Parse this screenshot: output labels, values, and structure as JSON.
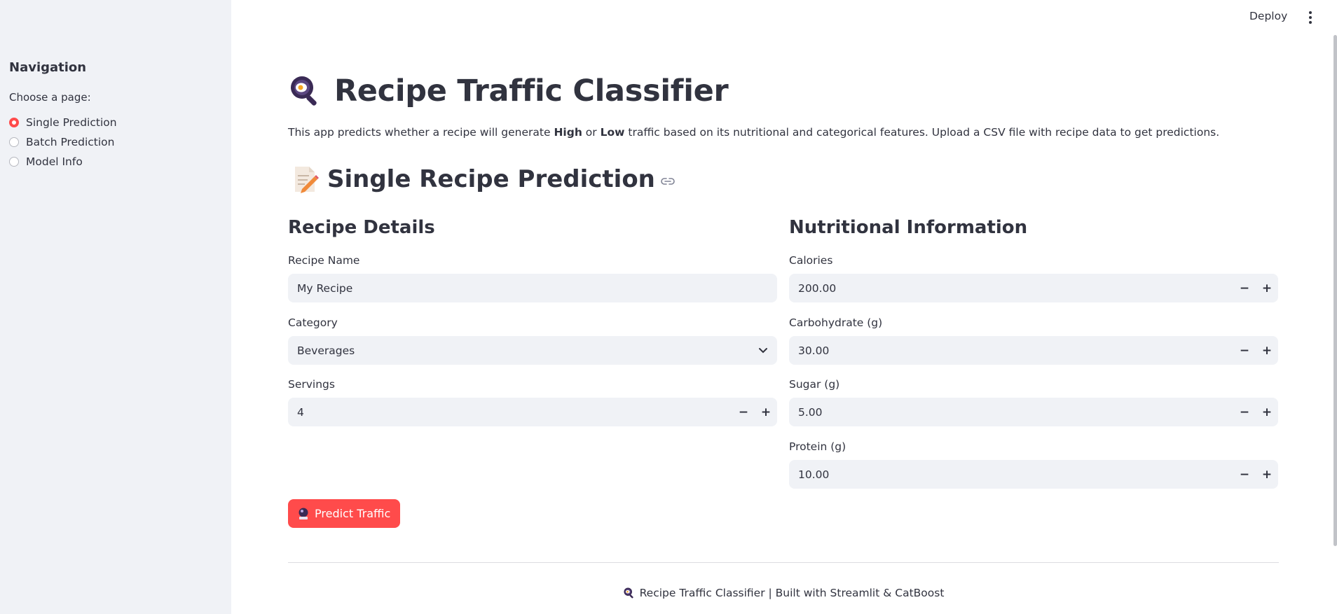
{
  "sidebar": {
    "heading": "Navigation",
    "choose_label": "Choose a page:",
    "options": [
      "Single Prediction",
      "Batch Prediction",
      "Model Info"
    ],
    "selected": "Single Prediction"
  },
  "header": {
    "deploy_label": "Deploy",
    "menu_icon": "kebab-menu-icon"
  },
  "main": {
    "title": "Recipe Traffic Classifier",
    "title_icon": "magnifier-egg-icon",
    "intro": {
      "part1": "This app predicts whether a recipe will generate ",
      "high": "High",
      "part2": " or ",
      "low": "Low",
      "part3": " traffic based on its nutritional and categorical features. Upload a CSV file with recipe data to get predictions."
    },
    "section_title": "Single Recipe Prediction",
    "section_icon": "memo-icon",
    "left_col": {
      "heading": "Recipe Details",
      "recipe_name": {
        "label": "Recipe Name",
        "value": "My Recipe"
      },
      "category": {
        "label": "Category",
        "value": "Beverages"
      },
      "servings": {
        "label": "Servings",
        "value": "4"
      }
    },
    "right_col": {
      "heading": "Nutritional Information",
      "calories": {
        "label": "Calories",
        "value": "200.00"
      },
      "carbohydrate": {
        "label": "Carbohydrate (g)",
        "value": "30.00"
      },
      "sugar": {
        "label": "Sugar (g)",
        "value": "5.00"
      },
      "protein": {
        "label": "Protein (g)",
        "value": "10.00"
      }
    },
    "stepper_minus": "−",
    "stepper_plus": "+",
    "predict_button": "Predict Traffic",
    "predict_icon": "crystal-ball-icon",
    "footer": "Recipe Traffic Classifier | Built with Streamlit & CatBoost"
  },
  "colors": {
    "accent": "#ff4b4b",
    "sidebar_bg": "#f0f2f6",
    "input_bg": "#f0f2f6",
    "text": "#31333f"
  }
}
